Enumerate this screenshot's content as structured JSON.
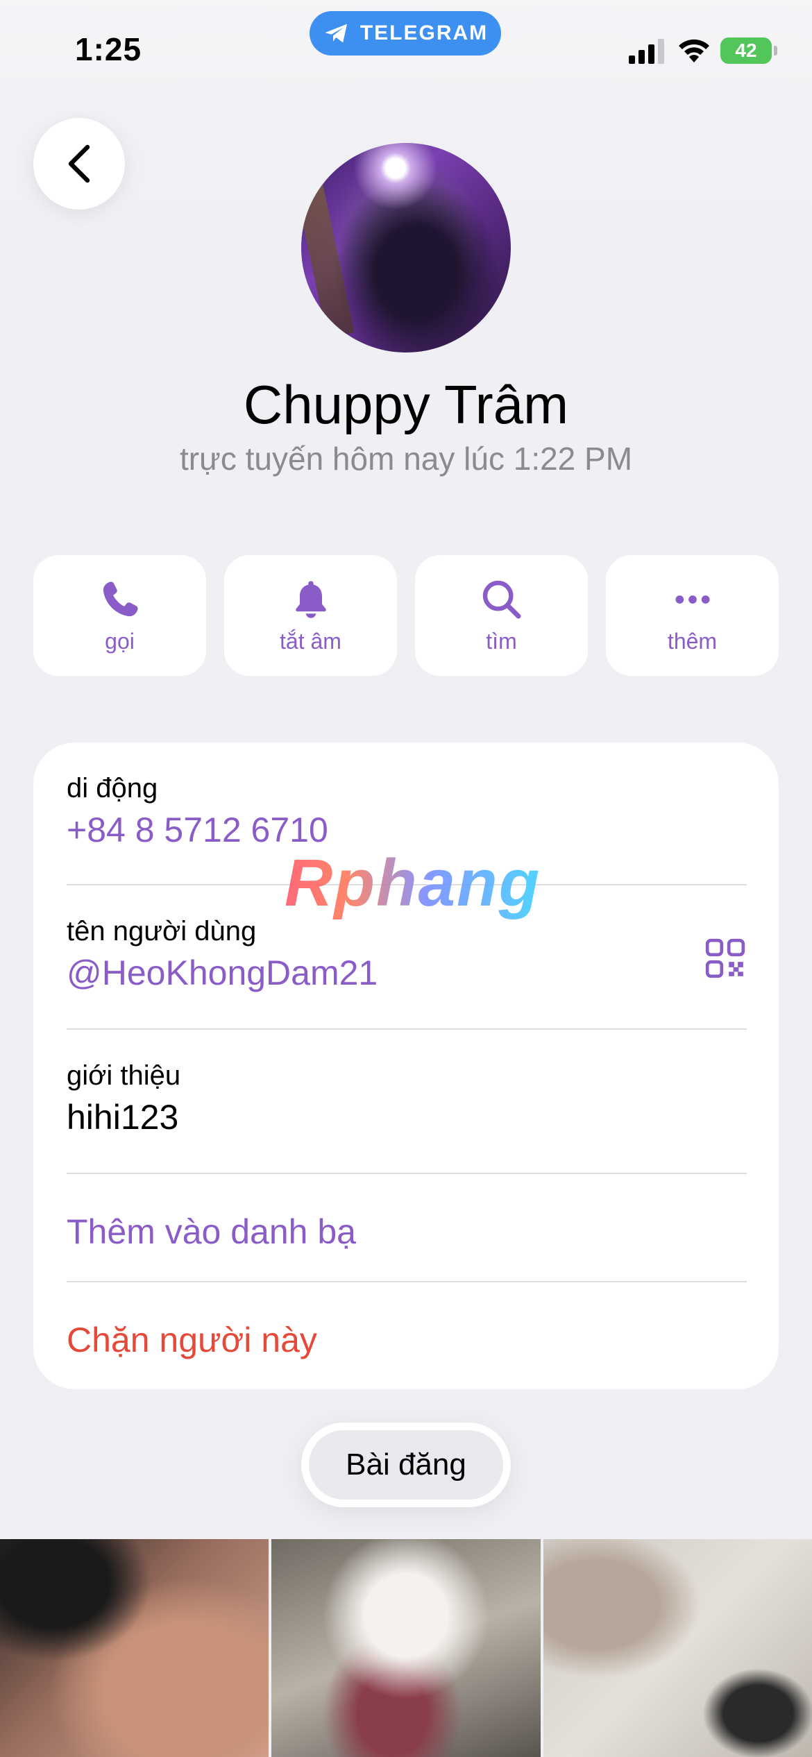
{
  "status_bar": {
    "time": "1:25",
    "app_pill": "TELEGRAM",
    "battery": "42"
  },
  "profile": {
    "name": "Chuppy Trâm",
    "last_seen": "trực tuyến hôm nay lúc 1:22 PM"
  },
  "actions": [
    {
      "label": "gọi",
      "icon": "phone-icon"
    },
    {
      "label": "tắt âm",
      "icon": "bell-icon"
    },
    {
      "label": "tìm",
      "icon": "search-icon"
    },
    {
      "label": "thêm",
      "icon": "more-icon"
    }
  ],
  "info": {
    "mobile_label": "di động",
    "mobile_value": "+84 8 5712 6710",
    "username_label": "tên người dùng",
    "username_value": "@HeoKhongDam21",
    "bio_label": "giới thiệu",
    "bio_value": "hihi123",
    "add_contact": "Thêm vào danh bạ",
    "block_user": "Chặn người này"
  },
  "watermark": "Rphang",
  "tabs": {
    "posts": "Bài đăng"
  },
  "colors": {
    "accent": "#8a5cc8",
    "destructive": "#e5493a",
    "telegram_blue": "#3d8ff0",
    "battery_green": "#52c65a"
  }
}
